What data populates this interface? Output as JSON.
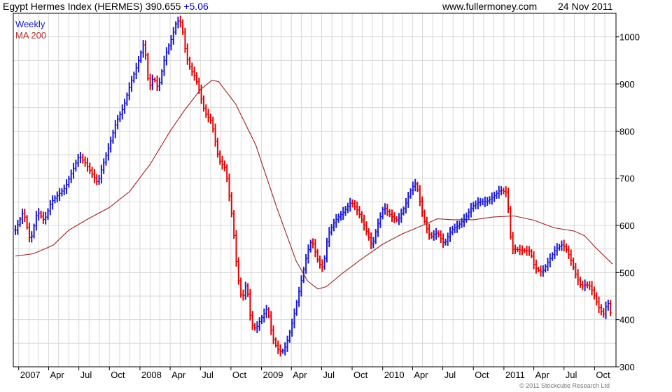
{
  "header": {
    "title": "Egypt Hermes Index (HERMES) 390.655",
    "change": "+5.06",
    "site": "www.fullermoney.com",
    "date": "24 Nov 2011"
  },
  "copyright": "© 2011 Stockcube Research Ltd",
  "colors": {
    "up": "#1a1ad0",
    "down": "#e00000",
    "ma": "#a02020",
    "grid": "#d8d8d8",
    "axis": "#000000"
  },
  "chart_data": {
    "type": "line",
    "grid": true,
    "legend_position": "top-left",
    "ylim": [
      300,
      1050
    ],
    "y_ticks": [
      300,
      400,
      500,
      600,
      700,
      800,
      900,
      1000
    ],
    "x_start": "2006-12-22",
    "x_end": "2011-11-24",
    "x_ticks": [
      {
        "date": "2007-01-01",
        "label": "2007"
      },
      {
        "date": "2007-04-01",
        "label": "Apr"
      },
      {
        "date": "2007-07-01",
        "label": "Jul"
      },
      {
        "date": "2007-10-01",
        "label": "Oct"
      },
      {
        "date": "2008-01-01",
        "label": "2008"
      },
      {
        "date": "2008-04-01",
        "label": "Apr"
      },
      {
        "date": "2008-07-01",
        "label": "Jul"
      },
      {
        "date": "2008-10-01",
        "label": "Oct"
      },
      {
        "date": "2009-01-01",
        "label": "2009"
      },
      {
        "date": "2009-04-01",
        "label": "Apr"
      },
      {
        "date": "2009-07-01",
        "label": "Jul"
      },
      {
        "date": "2009-10-01",
        "label": "Oct"
      },
      {
        "date": "2010-01-01",
        "label": "2010"
      },
      {
        "date": "2010-04-01",
        "label": "Apr"
      },
      {
        "date": "2010-07-01",
        "label": "Jul"
      },
      {
        "date": "2010-10-01",
        "label": "Oct"
      },
      {
        "date": "2011-01-01",
        "label": "2011"
      },
      {
        "date": "2011-04-01",
        "label": "Apr"
      },
      {
        "date": "2011-07-01",
        "label": "Jul"
      },
      {
        "date": "2011-10-01",
        "label": "Oct"
      }
    ],
    "series": [
      {
        "name": "Weekly",
        "style": "ohlc-bars",
        "points": [
          {
            "x": "2006-12-22",
            "y": 590
          },
          {
            "x": "2007-01-15",
            "y": 630
          },
          {
            "x": "2007-02-05",
            "y": 565
          },
          {
            "x": "2007-02-26",
            "y": 630
          },
          {
            "x": "2007-03-19",
            "y": 610
          },
          {
            "x": "2007-04-09",
            "y": 650
          },
          {
            "x": "2007-04-30",
            "y": 665
          },
          {
            "x": "2007-05-21",
            "y": 680
          },
          {
            "x": "2007-06-11",
            "y": 715
          },
          {
            "x": "2007-07-02",
            "y": 748
          },
          {
            "x": "2007-07-23",
            "y": 730
          },
          {
            "x": "2007-08-13",
            "y": 705
          },
          {
            "x": "2007-08-27",
            "y": 690
          },
          {
            "x": "2007-09-10",
            "y": 725
          },
          {
            "x": "2007-10-01",
            "y": 770
          },
          {
            "x": "2007-10-22",
            "y": 820
          },
          {
            "x": "2007-11-12",
            "y": 850
          },
          {
            "x": "2007-12-03",
            "y": 900
          },
          {
            "x": "2007-12-24",
            "y": 940
          },
          {
            "x": "2008-01-14",
            "y": 990
          },
          {
            "x": "2008-01-28",
            "y": 890
          },
          {
            "x": "2008-02-11",
            "y": 915
          },
          {
            "x": "2008-02-25",
            "y": 890
          },
          {
            "x": "2008-03-17",
            "y": 960
          },
          {
            "x": "2008-04-07",
            "y": 1000
          },
          {
            "x": "2008-04-21",
            "y": 1035
          },
          {
            "x": "2008-05-05",
            "y": 1030
          },
          {
            "x": "2008-05-19",
            "y": 960
          },
          {
            "x": "2008-06-02",
            "y": 930
          },
          {
            "x": "2008-06-16",
            "y": 915
          },
          {
            "x": "2008-06-30",
            "y": 880
          },
          {
            "x": "2008-07-14",
            "y": 840
          },
          {
            "x": "2008-08-04",
            "y": 820
          },
          {
            "x": "2008-08-25",
            "y": 740
          },
          {
            "x": "2008-09-15",
            "y": 720
          },
          {
            "x": "2008-10-06",
            "y": 610
          },
          {
            "x": "2008-10-20",
            "y": 500
          },
          {
            "x": "2008-11-03",
            "y": 440
          },
          {
            "x": "2008-11-17",
            "y": 480
          },
          {
            "x": "2008-12-01",
            "y": 390
          },
          {
            "x": "2008-12-15",
            "y": 380
          },
          {
            "x": "2008-12-29",
            "y": 400
          },
          {
            "x": "2009-01-19",
            "y": 425
          },
          {
            "x": "2009-02-02",
            "y": 365
          },
          {
            "x": "2009-02-16",
            "y": 340
          },
          {
            "x": "2009-03-02",
            "y": 330
          },
          {
            "x": "2009-03-16",
            "y": 345
          },
          {
            "x": "2009-04-06",
            "y": 400
          },
          {
            "x": "2009-04-27",
            "y": 470
          },
          {
            "x": "2009-05-18",
            "y": 540
          },
          {
            "x": "2009-06-01",
            "y": 570
          },
          {
            "x": "2009-06-22",
            "y": 520
          },
          {
            "x": "2009-07-06",
            "y": 510
          },
          {
            "x": "2009-07-20",
            "y": 580
          },
          {
            "x": "2009-08-10",
            "y": 610
          },
          {
            "x": "2009-09-07",
            "y": 630
          },
          {
            "x": "2009-09-28",
            "y": 650
          },
          {
            "x": "2009-10-19",
            "y": 630
          },
          {
            "x": "2009-11-09",
            "y": 595
          },
          {
            "x": "2009-11-30",
            "y": 555
          },
          {
            "x": "2009-12-14",
            "y": 595
          },
          {
            "x": "2010-01-04",
            "y": 640
          },
          {
            "x": "2010-01-25",
            "y": 620
          },
          {
            "x": "2010-02-15",
            "y": 610
          },
          {
            "x": "2010-03-08",
            "y": 640
          },
          {
            "x": "2010-03-29",
            "y": 680
          },
          {
            "x": "2010-04-12",
            "y": 690
          },
          {
            "x": "2010-04-26",
            "y": 640
          },
          {
            "x": "2010-05-10",
            "y": 600
          },
          {
            "x": "2010-05-24",
            "y": 575
          },
          {
            "x": "2010-06-14",
            "y": 585
          },
          {
            "x": "2010-07-05",
            "y": 560
          },
          {
            "x": "2010-07-26",
            "y": 590
          },
          {
            "x": "2010-08-16",
            "y": 600
          },
          {
            "x": "2010-09-06",
            "y": 615
          },
          {
            "x": "2010-09-27",
            "y": 640
          },
          {
            "x": "2010-10-18",
            "y": 650
          },
          {
            "x": "2010-11-08",
            "y": 650
          },
          {
            "x": "2010-11-29",
            "y": 660
          },
          {
            "x": "2010-12-20",
            "y": 675
          },
          {
            "x": "2011-01-10",
            "y": 670
          },
          {
            "x": "2011-01-24",
            "y": 550
          },
          {
            "x": "2011-03-21",
            "y": 545
          },
          {
            "x": "2011-04-04",
            "y": 510
          },
          {
            "x": "2011-04-25",
            "y": 500
          },
          {
            "x": "2011-05-16",
            "y": 525
          },
          {
            "x": "2011-06-06",
            "y": 550
          },
          {
            "x": "2011-06-27",
            "y": 560
          },
          {
            "x": "2011-07-11",
            "y": 545
          },
          {
            "x": "2011-07-25",
            "y": 520
          },
          {
            "x": "2011-08-08",
            "y": 490
          },
          {
            "x": "2011-08-22",
            "y": 470
          },
          {
            "x": "2011-09-05",
            "y": 475
          },
          {
            "x": "2011-09-19",
            "y": 470
          },
          {
            "x": "2011-10-03",
            "y": 445
          },
          {
            "x": "2011-10-17",
            "y": 420
          },
          {
            "x": "2011-10-31",
            "y": 410
          },
          {
            "x": "2011-11-07",
            "y": 440
          },
          {
            "x": "2011-11-14",
            "y": 430
          },
          {
            "x": "2011-11-24",
            "y": 391
          }
        ]
      },
      {
        "name": "MA 200",
        "style": "line",
        "points": [
          {
            "x": "2006-12-22",
            "y": 535
          },
          {
            "x": "2007-02-15",
            "y": 540
          },
          {
            "x": "2007-04-15",
            "y": 558
          },
          {
            "x": "2007-06-01",
            "y": 590
          },
          {
            "x": "2007-08-01",
            "y": 615
          },
          {
            "x": "2007-10-01",
            "y": 638
          },
          {
            "x": "2007-12-01",
            "y": 672
          },
          {
            "x": "2008-02-01",
            "y": 730
          },
          {
            "x": "2008-04-01",
            "y": 800
          },
          {
            "x": "2008-05-15",
            "y": 845
          },
          {
            "x": "2008-07-01",
            "y": 888
          },
          {
            "x": "2008-08-05",
            "y": 908
          },
          {
            "x": "2008-08-25",
            "y": 905
          },
          {
            "x": "2008-10-15",
            "y": 858
          },
          {
            "x": "2008-12-15",
            "y": 770
          },
          {
            "x": "2009-02-15",
            "y": 640
          },
          {
            "x": "2009-04-15",
            "y": 525
          },
          {
            "x": "2009-05-20",
            "y": 482
          },
          {
            "x": "2009-06-20",
            "y": 465
          },
          {
            "x": "2009-07-15",
            "y": 470
          },
          {
            "x": "2009-09-01",
            "y": 498
          },
          {
            "x": "2009-11-01",
            "y": 530
          },
          {
            "x": "2010-01-01",
            "y": 560
          },
          {
            "x": "2010-03-01",
            "y": 582
          },
          {
            "x": "2010-05-01",
            "y": 600
          },
          {
            "x": "2010-06-15",
            "y": 614
          },
          {
            "x": "2010-08-01",
            "y": 612
          },
          {
            "x": "2010-10-01",
            "y": 612
          },
          {
            "x": "2010-12-01",
            "y": 618
          },
          {
            "x": "2011-02-01",
            "y": 620
          },
          {
            "x": "2011-04-01",
            "y": 611
          },
          {
            "x": "2011-06-01",
            "y": 595
          },
          {
            "x": "2011-08-01",
            "y": 588
          },
          {
            "x": "2011-09-01",
            "y": 578
          },
          {
            "x": "2011-10-01",
            "y": 555
          },
          {
            "x": "2011-11-24",
            "y": 518
          }
        ]
      }
    ]
  }
}
